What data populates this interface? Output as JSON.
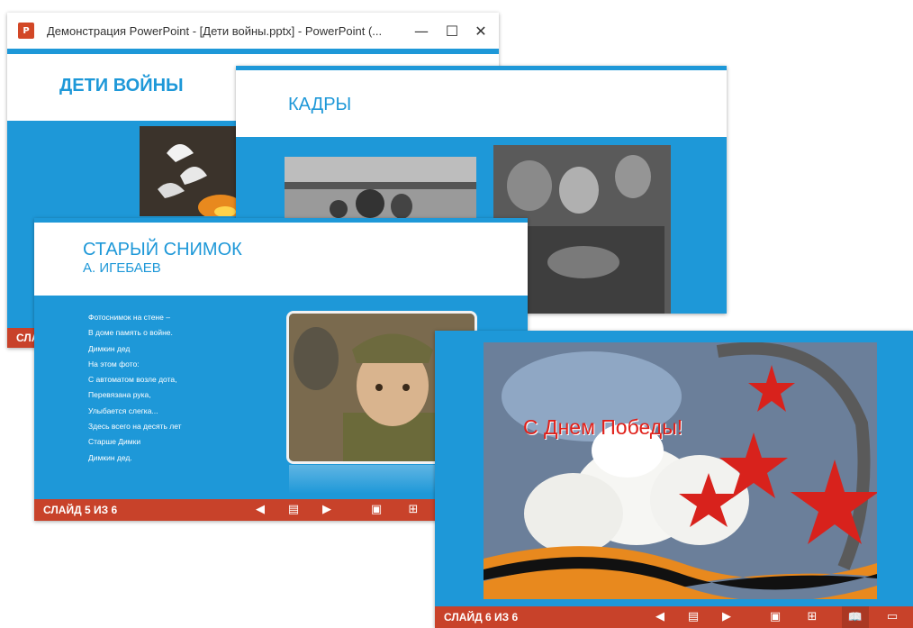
{
  "window": {
    "title": "Демонстрация PowerPoint - [Дети войны.pptx] - PowerPoint (...",
    "app_icon_text": "P",
    "minimize_icon": "minimize-icon",
    "maximize_icon": "maximize-icon",
    "close_icon": "close-icon"
  },
  "slides": {
    "slide1": {
      "title": "ДЕТИ ВОЙНЫ",
      "status_partial": "СЛАЙ"
    },
    "slide2": {
      "title": "КАДРЫ"
    },
    "slide5": {
      "title": "СТАРЫЙ СНИМОК",
      "subtitle": "А. ИГЕБАЕВ",
      "poem": [
        "Фотоснимок на стене –",
        "В доме память о войне.",
        "Димкин дед",
        "На этом фото:",
        "С автоматом возле дота,",
        "Перевязана рука,",
        "Улыбается слегка...",
        "Здесь всего на десять лет",
        "Старше Димки",
        "Димкин дед."
      ],
      "status": "СЛАЙД 5 ИЗ 6"
    },
    "slide6": {
      "greeting": "С Днем Победы!",
      "status": "СЛАЙД 6 ИЗ 6"
    }
  },
  "colors": {
    "accent_blue": "#1e98d8",
    "status_red": "#c8422a",
    "greeting_red": "#e0201a"
  }
}
